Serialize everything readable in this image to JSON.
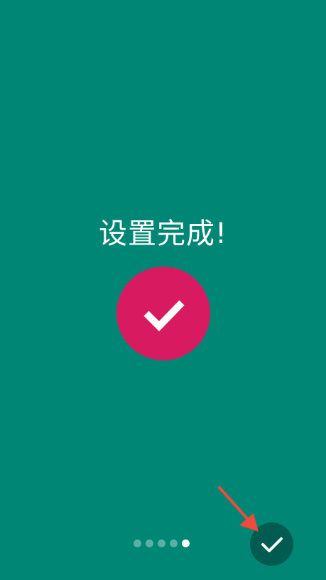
{
  "screen": {
    "title": "设置完成!",
    "background_color": "#008675",
    "badge_color": "#d81b60",
    "badge_icon": "checkmark-icon"
  },
  "pager": {
    "total_pages": 5,
    "active_page": 5
  },
  "done_button": {
    "icon": "checkmark-icon",
    "color": "#005b50"
  },
  "annotation": {
    "arrow_color": "#f04a3c"
  }
}
